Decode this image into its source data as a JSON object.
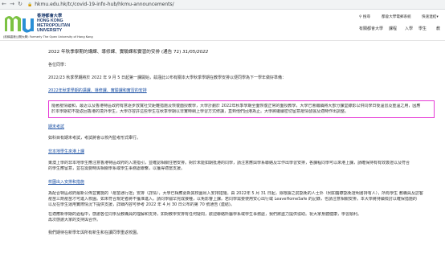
{
  "browser": {
    "back_icon": "arrow-left-icon",
    "forward_icon": "arrow-right-icon",
    "reload_icon": "reload-icon",
    "url": "hkmu.edu.hk/tc/covid-19-info-hub/hkmu-announcements/"
  },
  "site": {
    "logo_mark": "mu",
    "logo_cn": "香港都會大學",
    "logo_en1": "HONG KONG",
    "logo_en2": "METROPOLITAN",
    "logo_en3": "UNIVERSITY",
    "logo_sub": "(前稱香港公開大學) Formerly The Open University of Hong Kong",
    "top_links": [
      "搜尋",
      "都會大學電郵系統",
      "快速連結"
    ],
    "nav_links": [
      "有關都會大學",
      "課程",
      "入學",
      "學生",
      "教"
    ]
  },
  "article": {
    "title": "2022 年秋季學期的講課、導修課、實驗課和實習的安排 (通告 72)",
    "title_date": "31/05/2022",
    "salutation": "各位同學：",
    "intro": "2022/23 秋季學期將於 2022 年 9 月 5 日起第一課開始，茲謹此公布有關本大學秋季學期在教學安排以便同學為下一學年做好準備：",
    "link1": "2022年秋季學期的講課、導修課、實驗課和實習的安排",
    "highlight": [
      "隨著疫情緩和，最近以及香港特區政府有意逐步放寬社交距離措施及恢復面授教學，大學計劃於 2022年秋季學期全面恢復正常的面授教學，大學已會繼續將大部分課堂錄影以供同學日後溫習及重溫之用，因應",
      "於本學期初不能返回香港的境外學生，大學亦容許這些學生在秋季學期以非實時網上學習方式修讀，直到他們回港為止。大學將繼續密切留意疫情發展及適時作出調整。"
    ],
    "sec_exam": "期末考試",
    "exam_text": "如科目有期末考試，考試將會以校內監考形式舉行。",
    "sec_campus": "非本地學生來港上課",
    "campus_lines": [
      "東澳上學的非本地學生應注意香港特區政府的入境指引，並確認相關住宿安排。對於未能如期抵港的同學，請注意應與學系聯絡及早作出學習安排，各課程同學可以來港上課，請確保持有有效簽證以及符合",
      "的學生應留意，並在需要時與相關學系或學生事務處聯繫，以獲得適當支援。"
    ],
    "sec_vacc": "校園出入安排和措施",
    "vacc_lines": [
      "為配合特區政府最新公佈並實施的「疫苗通行證」安排（詳情），大學已相應更新其校園出入安排措施。由 2022年 5 月 31 日起，除根據之前豁免的人士外（例如醫療豁免證明書持有人），所有學生 教職員及訪客",
      "疫苗三劑疫苗才可進入校園。如未符合規定者將不獲准進入。請同學儘早完成接種，以免影響上課。若同學需要使用安心出行或 LeaveHomeSafe 的記錄，也請注意相關安排。本大學將持續檢討以確保措施的",
      "以及在學生運用實際情況下提供支援，詳細內容可參考 2022 年 4 月 30 日公布的第 70 號通告 (連結)。",
      "在適應新學期的過程中，感謝各位同學及教職員的理解和支持，如對教學安排有任何疑問，歡迎聯絡所屬學系或學生事務處，我們將盡力提供協助。祝大家身體健康，學習順利。",
      "再次感謝大家的支持與合作。"
    ],
    "signoff": "我們期待在新學年與所有新生和在讀同學重返校園。"
  }
}
